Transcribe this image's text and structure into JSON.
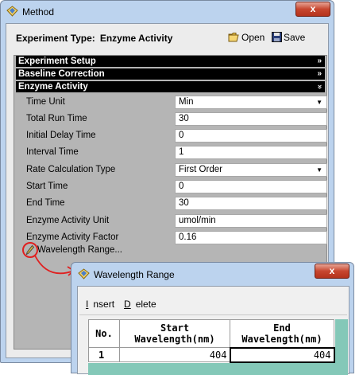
{
  "window": {
    "title": "Method",
    "close_glyph": "x"
  },
  "header": {
    "label": "Experiment Type:",
    "value": "Enzyme Activity",
    "open_label": "Open",
    "save_label": "Save"
  },
  "sections": [
    {
      "label": "Experiment Setup",
      "chevron": "»"
    },
    {
      "label": "Baseline Correction",
      "chevron": "»"
    },
    {
      "label": "Enzyme Activity",
      "chevron": "»"
    }
  ],
  "fields": [
    {
      "label": "Time Unit",
      "value": "Min",
      "type": "dropdown"
    },
    {
      "label": "Total Run Time",
      "value": "30",
      "type": "text"
    },
    {
      "label": "Initial Delay Time",
      "value": "0",
      "type": "text"
    },
    {
      "label": "Interval Time",
      "value": "1",
      "type": "text"
    },
    {
      "label": "Rate Calculation Type",
      "value": "First Order",
      "type": "dropdown"
    },
    {
      "label": "Start Time",
      "value": "0",
      "type": "text"
    },
    {
      "label": "End Time",
      "value": "30",
      "type": "text"
    },
    {
      "label": "Enzyme Activity Unit",
      "value": "umol/min",
      "type": "text"
    },
    {
      "label": "Enzyme Activity Factor",
      "value": "0.16",
      "type": "text"
    }
  ],
  "wavelength_link": "Wavelength Range...",
  "dialog": {
    "title": "Wavelength Range",
    "close_glyph": "x",
    "menu": {
      "insert": "Insert",
      "delete": "Delete"
    },
    "columns": {
      "no": "No.",
      "start_1": "Start",
      "start_2": "Wavelength(nm)",
      "end_1": "End",
      "end_2": "Wavelength(nm)"
    },
    "rows": [
      {
        "no": "1",
        "start": "404",
        "end": "404"
      }
    ]
  },
  "colors": {
    "annotation": "#e02020",
    "section_bar": "#000000",
    "grid_bg": "#84c8b8"
  }
}
